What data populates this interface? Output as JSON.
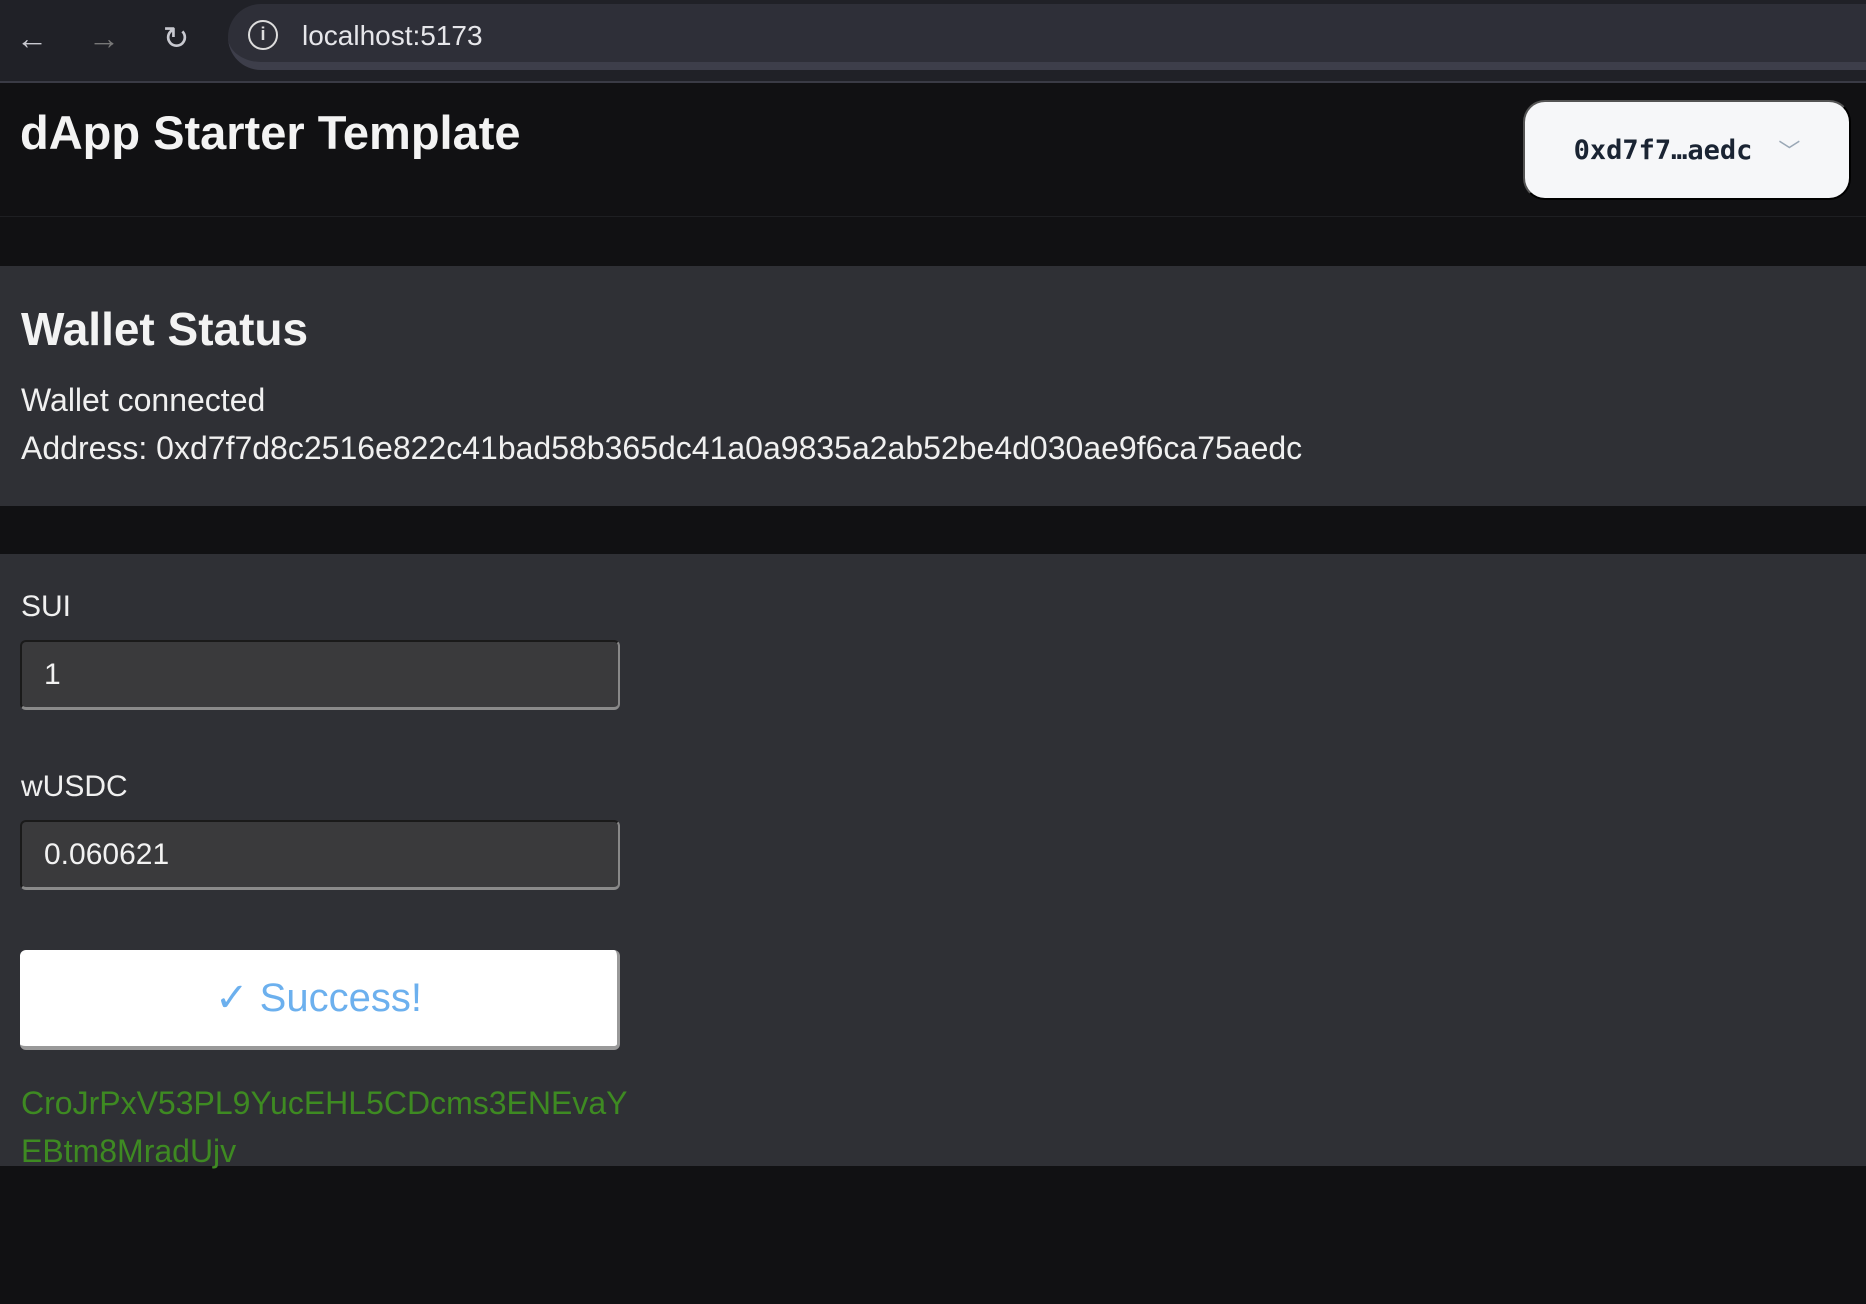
{
  "browser": {
    "url": "localhost:5173",
    "back_icon": "arrow-left",
    "forward_icon": "arrow-right",
    "reload_icon": "reload"
  },
  "header": {
    "title": "dApp Starter Template",
    "account_button": "0xd7f7…aedc"
  },
  "wallet_status": {
    "heading": "Wallet Status",
    "status": "Wallet connected",
    "address": "Address: 0xd7f7d8c2516e822c41bad58b365dc41a0a9835a2ab52be4d030ae9f6ca75aedc"
  },
  "swap": {
    "sui_label": "SUI",
    "sui_value": "1",
    "wusdc_label": "wUSDC",
    "wusdc_value": "0.060621",
    "submit_label": "✓ Success!",
    "tx_digest": "CroJrPxV53PL9YucEHL5CDcms3ENEvaYEBtm8MradUjv",
    "success_color": "#3e8a22",
    "button_text_color": "#6cb0ee"
  }
}
